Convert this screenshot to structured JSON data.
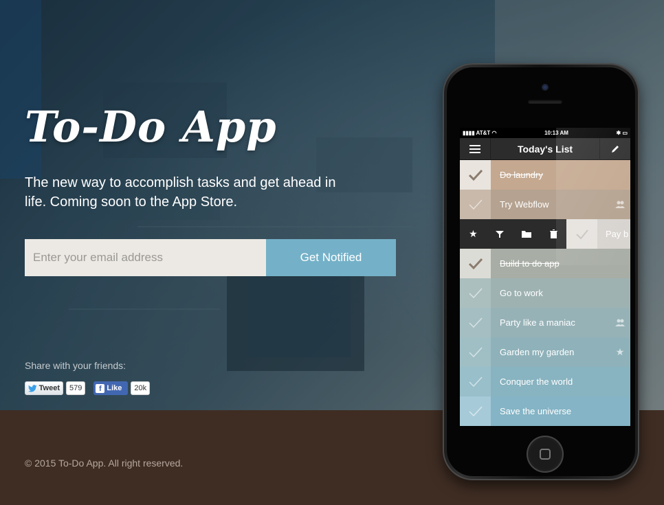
{
  "hero": {
    "title": "To-Do App",
    "tagline": "The new way to accomplish tasks and get ahead in life. Coming soon to the App Store.",
    "email_placeholder": "Enter your email address",
    "notify_label": "Get Notified",
    "share_label": "Share with your friends:"
  },
  "social": {
    "tweet_label": "Tweet",
    "tweet_count": "579",
    "like_label": "Like",
    "like_count": "20k"
  },
  "footer": {
    "copyright": "© 2015 To-Do App. All right reserved."
  },
  "phone": {
    "status": {
      "carrier": "AT&T",
      "time": "10:13 AM"
    },
    "nav_title": "Today's List",
    "tasks_top": [
      {
        "label": "Do laundry",
        "done": true,
        "bg": "#c4a88f",
        "check_bg": "#e9e4de",
        "trail": ""
      },
      {
        "label": "Try Webflow",
        "done": false,
        "bg": "#b5a290",
        "check_bg": "#c9b9aa",
        "trail": "people-icon"
      }
    ],
    "swipe_task": {
      "label": "Pay b"
    },
    "tasks_bottom": [
      {
        "label": "Build to do app",
        "done": true,
        "bg": "#a8ada5",
        "check_bg": "#dcdcd6",
        "trail": ""
      },
      {
        "label": "Go to work",
        "done": false,
        "bg": "#9fb2b2",
        "check_bg": "#acbfbf",
        "trail": ""
      },
      {
        "label": "Party like a maniac",
        "done": false,
        "bg": "#96b2b7",
        "check_bg": "#a4bec2",
        "trail": "people-icon"
      },
      {
        "label": "Garden my garden",
        "done": false,
        "bg": "#8fb2ba",
        "check_bg": "#9fbfc5",
        "trail": "star-icon"
      },
      {
        "label": "Conquer the world",
        "done": false,
        "bg": "#88b3c0",
        "check_bg": "#98bfca",
        "trail": ""
      },
      {
        "label": "Save the universe",
        "done": false,
        "bg": "#84b4c5",
        "check_bg": "#a6cad8",
        "trail": ""
      }
    ]
  }
}
